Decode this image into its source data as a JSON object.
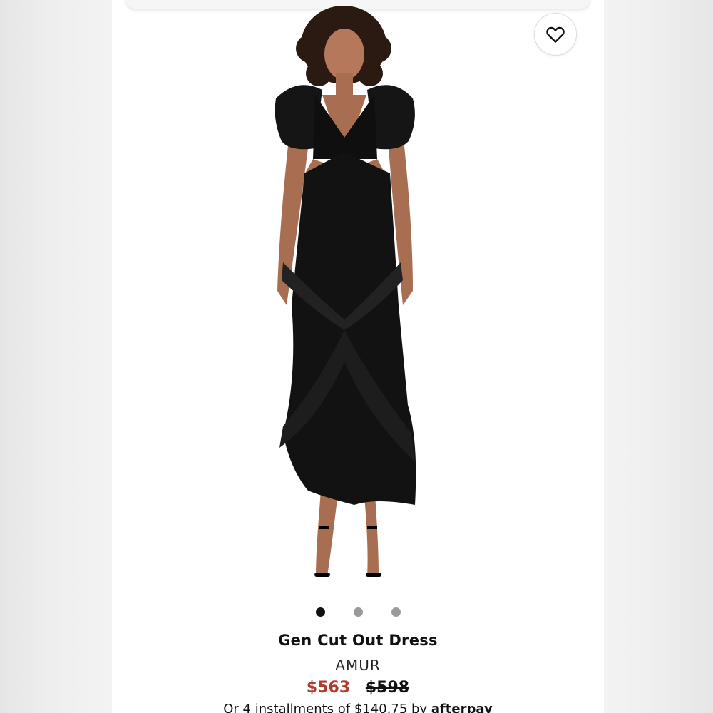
{
  "product": {
    "title": "Gen Cut Out Dress",
    "brand": "AMUR",
    "sale_price": "$563",
    "original_price": "$598",
    "installments_text": "Or 4 installments of $140.75 by",
    "installments_provider": "afterpay"
  },
  "gallery": {
    "image_count": 3,
    "active_index": 0
  },
  "favorite": {
    "icon": "heart-icon"
  },
  "colors": {
    "sale_price": "#b03a2e",
    "dress": "#111111",
    "active_dot": "#111111",
    "inactive_dot": "#9a9a9a"
  }
}
